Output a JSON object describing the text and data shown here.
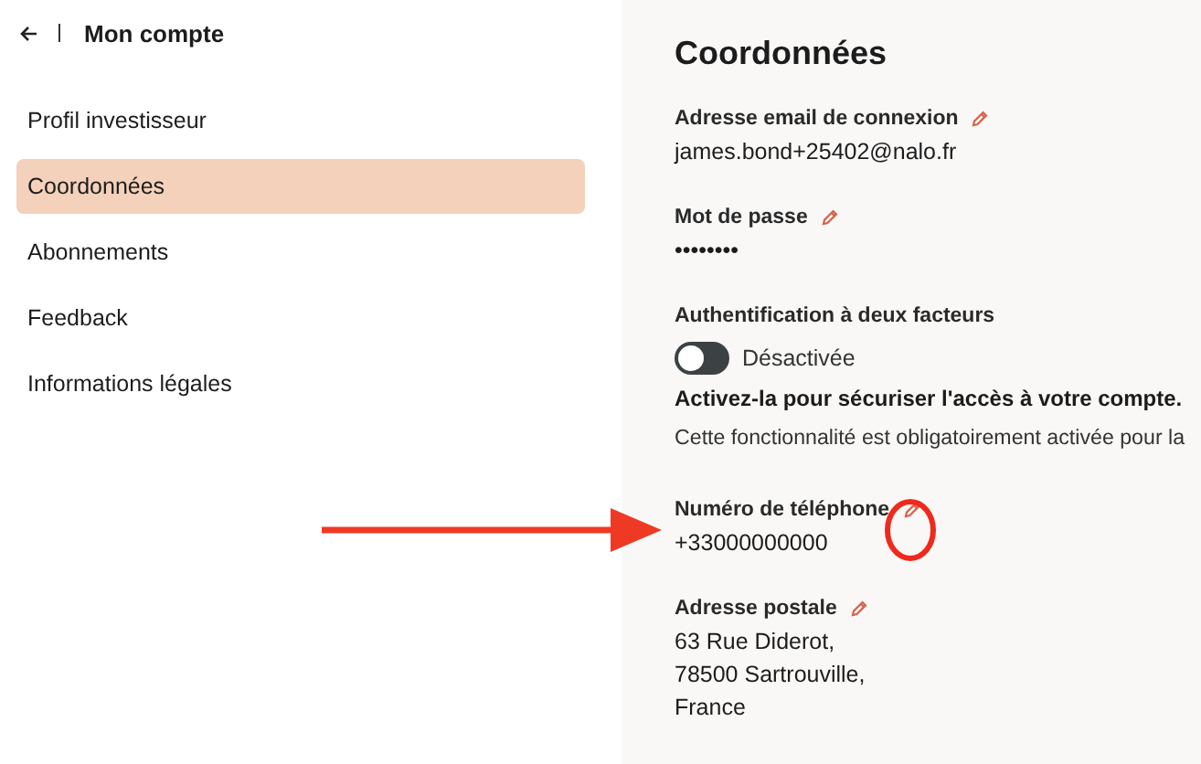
{
  "sidebar": {
    "title": "Mon compte",
    "items": [
      {
        "label": "Profil investisseur",
        "selected": false
      },
      {
        "label": "Coordonnées",
        "selected": true
      },
      {
        "label": "Abonnements",
        "selected": false
      },
      {
        "label": "Feedback",
        "selected": false
      },
      {
        "label": "Informations légales",
        "selected": false
      }
    ]
  },
  "content": {
    "title": "Coordonnées",
    "sections": [
      {
        "kind": "field",
        "label": "Adresse email de connexion",
        "editable": true,
        "lines": [
          "james.bond+25402@nalo.fr"
        ]
      },
      {
        "kind": "field",
        "label": "Mot de passe",
        "editable": true,
        "lines": [
          "••••••••"
        ]
      },
      {
        "kind": "toggle",
        "label": "Authentification à deux facteurs",
        "on": false,
        "state_label": "Désactivée",
        "emphasis": "Activez-la pour sécuriser l'accès à votre compte.",
        "note": "Cette fonctionnalité est obligatoirement activée pour la"
      },
      {
        "kind": "field",
        "label": "Numéro de téléphone",
        "editable": true,
        "lines": [
          "+33000000000"
        ]
      },
      {
        "kind": "field",
        "label": "Adresse postale",
        "editable": true,
        "lines": [
          "63 Rue Diderot,",
          "78500 Sartrouville,",
          "France"
        ]
      }
    ]
  },
  "annotations": {
    "pointer_arrow": true,
    "circled_pencil": true
  }
}
